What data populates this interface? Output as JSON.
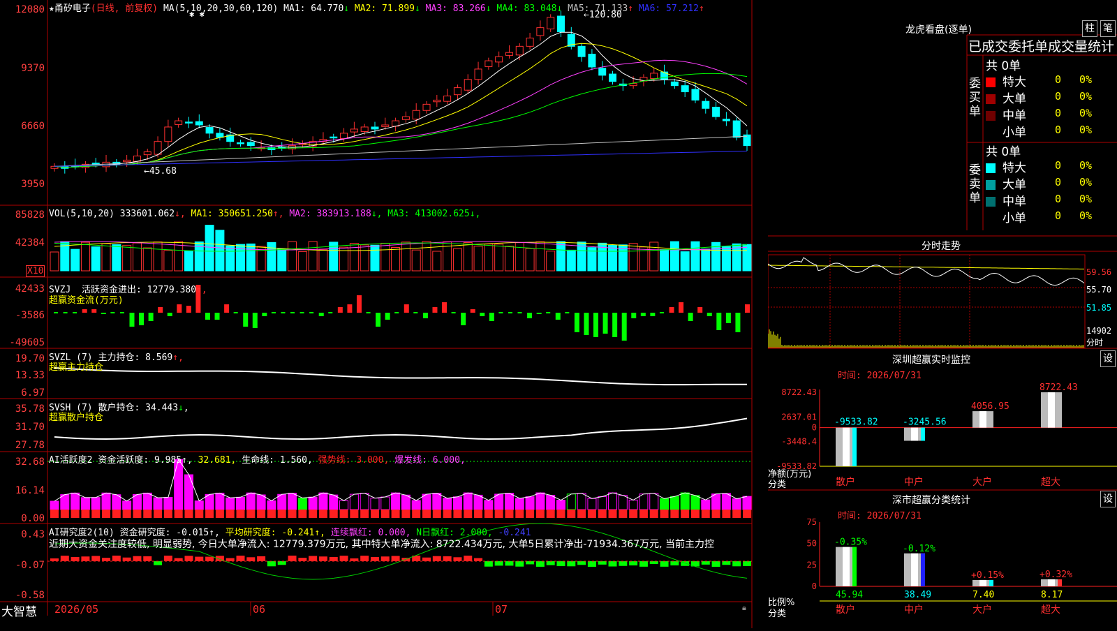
{
  "stock_name": "★甬矽电子",
  "period": "(日线, 前复权)",
  "bottom_bar": {
    "brand": "大智慧",
    "date_labels": [
      "2026/05",
      "06",
      "07"
    ]
  },
  "panels": {
    "price": {
      "ma_params": "MA(5,10,20,30,60,120)",
      "ma_items": [
        {
          "text": "MA1: 64.770",
          "arrow": "↓",
          "color": "#ffffff"
        },
        {
          "text": "MA2: 71.899",
          "arrow": "↓",
          "color": "#ffff00"
        },
        {
          "text": "MA3: 83.266",
          "arrow": "↓",
          "color": "#ff40ff"
        },
        {
          "text": "MA4: 83.048",
          "arrow": "↓",
          "color": "#00ff00"
        },
        {
          "text": "MA5: 71.133",
          "arrow": "↑",
          "color": "#c0c0c0"
        },
        {
          "text": "MA6: 57.212",
          "arrow": "↑",
          "color": "#3030ff"
        }
      ],
      "y_labels": [
        "12080",
        "9370",
        "6660",
        "3950"
      ],
      "high_label": "120.80",
      "low_label": "45.68"
    },
    "vol": {
      "title": "VOL(5,10,20)",
      "value": "333601.062",
      "ma_items": [
        {
          "text": "MA1: 350651.250",
          "arrow": "↑",
          "color": "#ffff00"
        },
        {
          "text": "MA2: 383913.188",
          "arrow": "↓",
          "color": "#ff40ff"
        },
        {
          "text": "MA3: 413002.625",
          "arrow": "↓",
          "color": "#00ff00"
        }
      ],
      "y_labels": [
        "85828",
        "42384"
      ],
      "unit": "X10"
    },
    "svzj": {
      "title": "SVZJ",
      "line1": "活跃资金进出: 12779.380",
      "line2": "超赢资金流(万元)",
      "y_labels": [
        "42433",
        "-3586",
        "-49605"
      ]
    },
    "svzl": {
      "title": "SVZL (7)",
      "line1": "主力持仓: 8.569",
      "line2": "超赢主力持仓",
      "y_labels": [
        "19.70",
        "13.33",
        "6.97"
      ]
    },
    "svsh": {
      "title": "SVSH (7)",
      "line1": "散户持仓: 34.443",
      "line2": "超赢散户持仓",
      "y_labels": [
        "35.78",
        "31.70",
        "27.78"
      ]
    },
    "ai2": {
      "title": "AI活跃度2",
      "items": [
        {
          "text": "资金活跃度: 9.985",
          "color": "#ffffff"
        },
        {
          "text": "32.681,",
          "color": "#ffff00"
        },
        {
          "text": "生命线: 1.560,",
          "color": "#ffffff"
        },
        {
          "text": "强势线: 3.000,",
          "color": "#ff2020"
        },
        {
          "text": "爆发线: 6.000,",
          "color": "#ff40ff"
        }
      ],
      "y_labels": [
        "32.68",
        "16.14",
        "0.00"
      ]
    },
    "ai_research": {
      "title": "AI研究度2(10)",
      "items": [
        {
          "text": "资金研究度: -0.015",
          "color": "#ffffff"
        },
        {
          "text": "平均研究度: -0.241",
          "color": "#ffff00"
        },
        {
          "text": "连续飘红: 0.000,",
          "color": "#ff40ff"
        },
        {
          "text": "N日飘红: 2.000,",
          "color": "#00ff00"
        },
        {
          "text": "-0.241",
          "color": "#4040ff"
        }
      ],
      "summary": "近期大资金关注度较低, 明显弱势, 今日大单净流入: 12779.379万元, 其中特大单净流入: 8722.434万元, 大单5日累计净出-71934.367万元, 当前主力控",
      "y_labels": [
        "0.43",
        "-0.07",
        "-0.58"
      ]
    }
  },
  "right_panel": {
    "lhb": {
      "title": "龙虎看盘(逐单)",
      "tabs": [
        "柱",
        "笔"
      ],
      "header": "已成交委托单成交量统计",
      "buy": {
        "side_label": "委买单",
        "total": "共 0单",
        "rows": [
          {
            "name": "特大",
            "count": "0",
            "pct": "0%",
            "color": "#ff0000"
          },
          {
            "name": "大单",
            "count": "0",
            "pct": "0%",
            "color": "#a00000"
          },
          {
            "name": "中单",
            "count": "0",
            "pct": "0%",
            "color": "#700000"
          },
          {
            "name": "小单",
            "count": "0",
            "pct": "0%",
            "color": "#000000"
          }
        ]
      },
      "sell": {
        "side_label": "委卖单",
        "total": "共 0单",
        "rows": [
          {
            "name": "特大",
            "count": "0",
            "pct": "0%",
            "color": "#00ffff"
          },
          {
            "name": "大单",
            "count": "0",
            "pct": "0%",
            "color": "#00a0a0"
          },
          {
            "name": "中单",
            "count": "0",
            "pct": "0%",
            "color": "#007070"
          },
          {
            "name": "小单",
            "count": "0",
            "pct": "0%",
            "color": "#000000"
          }
        ]
      }
    },
    "intraday": {
      "title": "分时走势",
      "right_labels": [
        "59.56",
        "55.70",
        "51.85",
        "14902",
        "分时"
      ]
    },
    "monitor": {
      "title": "深圳超赢实时监控",
      "settings": "设",
      "time": "时间: 2026/07/31",
      "y_labels": [
        "8722.43",
        "2637.01",
        "0",
        "-3448.4",
        "-9533.82"
      ],
      "ylabel": "净额(万元)",
      "xlabel": "分类",
      "categories": [
        "散户",
        "中户",
        "大户",
        "超大"
      ],
      "values": [
        -9533.82,
        -3245.56,
        4056.95,
        8722.43
      ],
      "value_labels": [
        "-9533.82",
        "-3245.56",
        "4056.95",
        "8722.43"
      ],
      "value_colors": [
        "#00ffff",
        "#00ffff",
        "#ff3030",
        "#ff3030"
      ]
    },
    "classification": {
      "title": "深市超赢分类统计",
      "settings": "设",
      "time": "时间: 2026/07/31",
      "y_labels": [
        "75",
        "50",
        "25",
        "0"
      ],
      "ylabel": "比例%",
      "xlabel": "分类",
      "categories": [
        "散户",
        "中户",
        "大户",
        "超大"
      ],
      "values": [
        45.94,
        38.49,
        7.4,
        8.17
      ],
      "value_labels": [
        "45.94",
        "38.49",
        "7.40",
        "8.17"
      ],
      "change_labels": [
        "-0.35%",
        "-0.12%",
        "+0.15%",
        "+0.32%"
      ],
      "change_colors": [
        "#00ff00",
        "#00ff00",
        "#ff3030",
        "#ff3030"
      ],
      "bottom_colors": [
        "#00ff00",
        "#00ffff",
        "#ffff00",
        "#ffff00"
      ],
      "bar_colors": [
        "#00ff00",
        "#2020ff",
        "#00ffff",
        "#ff3030"
      ]
    }
  },
  "chart_data": [
    {
      "type": "candlestick",
      "title": "甬矽电子 (日线, 前复权)",
      "x": [
        "2026/05",
        "06",
        "07"
      ],
      "ylim": [
        3950,
        12080
      ],
      "annotations": [
        "120.80",
        "45.68"
      ],
      "closes": [
        48,
        47,
        48,
        49,
        49,
        50,
        49,
        51,
        53,
        55,
        60,
        67,
        70,
        69,
        68,
        64,
        62,
        60,
        59,
        58,
        57,
        56,
        57,
        58,
        59,
        60,
        61,
        62,
        64,
        66,
        67,
        66,
        68,
        70,
        72,
        75,
        78,
        80,
        82,
        86,
        90,
        95,
        99,
        101,
        103,
        106,
        110,
        115,
        120,
        113,
        106,
        101,
        96,
        92,
        89,
        87,
        88,
        91,
        93,
        90,
        87,
        84,
        80,
        76,
        72,
        70,
        62,
        58
      ]
    },
    {
      "type": "bar",
      "title": "VOL(5,10,20)",
      "ylim": [
        0,
        85828
      ]
    },
    {
      "type": "bar",
      "title": "SVZJ 超赢资金流(万元)",
      "ylim": [
        -49605,
        42433
      ],
      "values": [
        0,
        0,
        0,
        5,
        5,
        -2,
        0,
        0,
        -20,
        -18,
        -12,
        8,
        -5,
        12,
        10,
        40,
        -10,
        -10,
        12,
        0,
        -20,
        -22,
        -5,
        0,
        0,
        0,
        0,
        0,
        -5,
        0,
        8,
        12,
        25,
        0,
        -20,
        -10,
        0,
        12,
        0,
        -8,
        8,
        15,
        0,
        -18,
        5,
        -5,
        -12,
        0,
        0,
        0,
        -8,
        -2,
        0,
        -10,
        0,
        -28,
        -32,
        -35,
        -30,
        -35,
        -40,
        -8,
        -5,
        -5,
        0,
        8,
        15,
        -12,
        8,
        -5,
        -25,
        -15,
        -28,
        12
      ]
    },
    {
      "type": "line",
      "title": "SVZL 超赢主力持仓",
      "ylim": [
        6.97,
        19.7
      ]
    },
    {
      "type": "line",
      "title": "SVSH 超赢散户持仓",
      "ylim": [
        27.78,
        35.78
      ]
    },
    {
      "type": "bar",
      "title": "AI活跃度2",
      "ylim": [
        0,
        32.68
      ]
    },
    {
      "type": "bar",
      "title": "AI研究度2(10)",
      "ylim": [
        -0.58,
        0.43
      ]
    },
    {
      "type": "bar",
      "title": "深圳超赢实时监控",
      "categories": [
        "散户",
        "中户",
        "大户",
        "超大"
      ],
      "values": [
        -9533.82,
        -3245.56,
        4056.95,
        8722.43
      ],
      "ylim": [
        -9533.82,
        8722.43
      ],
      "ylabel": "净额(万元)"
    },
    {
      "type": "bar",
      "title": "深市超赢分类统计",
      "categories": [
        "散户",
        "中户",
        "大户",
        "超大"
      ],
      "values": [
        45.94,
        38.49,
        7.4,
        8.17
      ],
      "ylim": [
        0,
        75
      ],
      "ylabel": "比例%"
    }
  ]
}
